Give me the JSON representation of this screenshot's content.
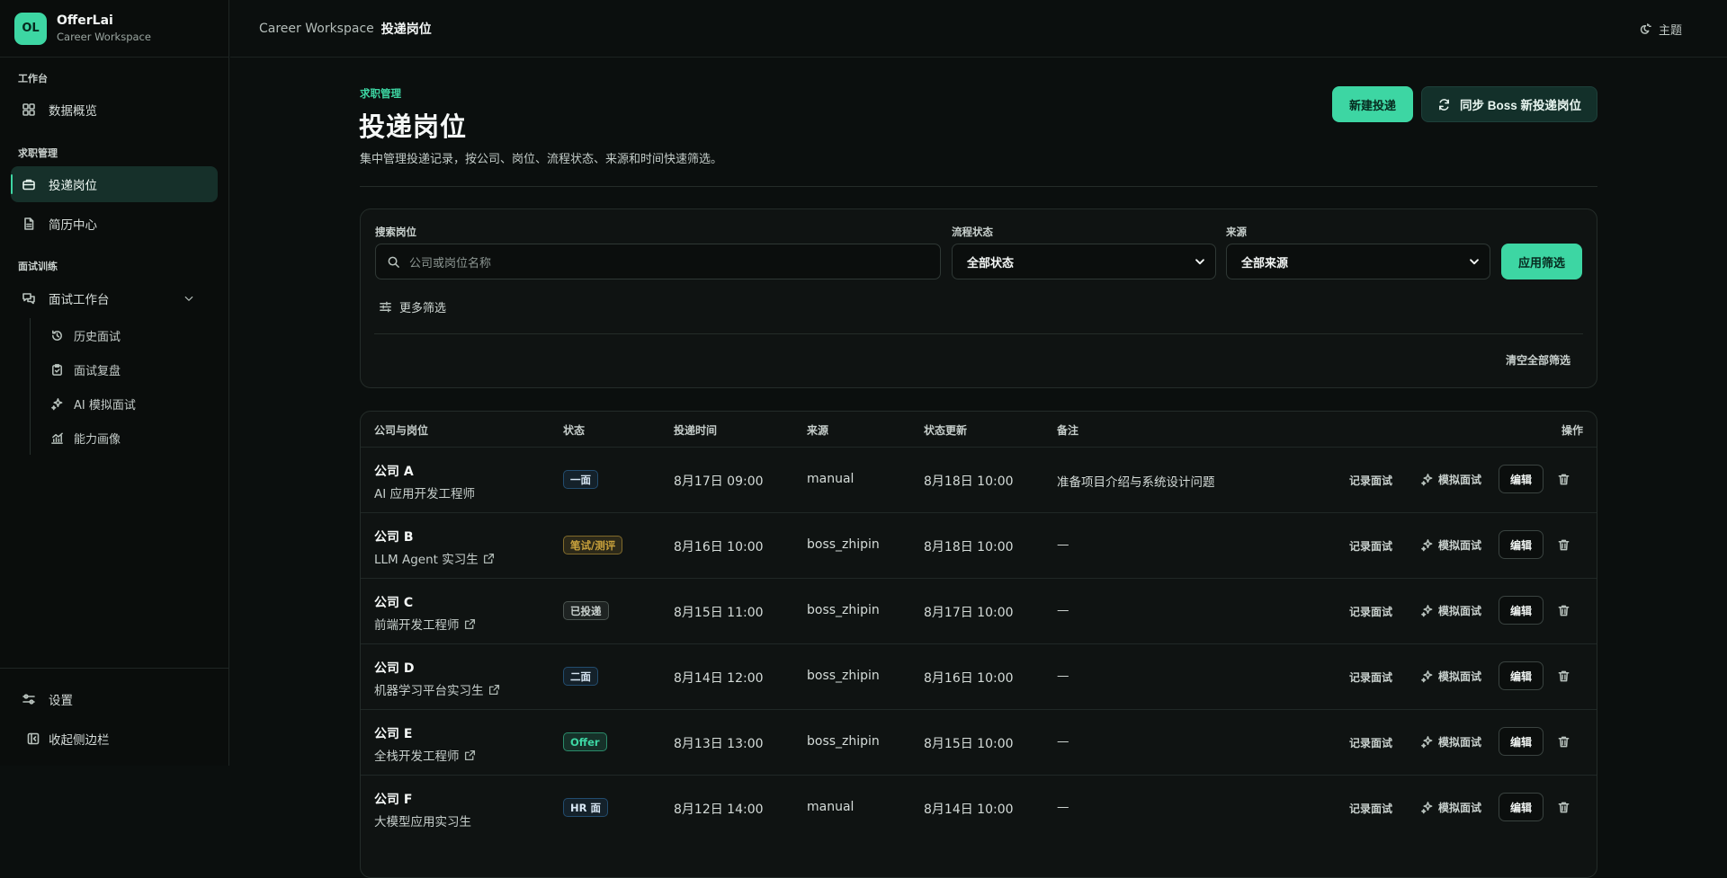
{
  "brand": {
    "logo": "OL",
    "name": "OfferLai",
    "subtitle": "Career Workspace"
  },
  "sidebar": {
    "sections": [
      {
        "title": "工作台",
        "items": [
          {
            "label": "数据概览",
            "icon": "grid-icon"
          }
        ]
      },
      {
        "title": "求职管理",
        "items": [
          {
            "label": "投递岗位",
            "icon": "briefcase-icon",
            "active": true
          },
          {
            "label": "简历中心",
            "icon": "document-icon"
          }
        ]
      },
      {
        "title": "面试训练",
        "items": [
          {
            "label": "面试工作台",
            "icon": "chat-icon",
            "expanded": true
          }
        ]
      }
    ],
    "subitems": [
      {
        "label": "历史面试",
        "icon": "history-icon"
      },
      {
        "label": "面试复盘",
        "icon": "clipboard-icon"
      },
      {
        "label": "AI 模拟面试",
        "icon": "sparkles-icon"
      },
      {
        "label": "能力画像",
        "icon": "chart-icon"
      }
    ],
    "bottom": [
      {
        "label": "设置",
        "icon": "settings-icon"
      },
      {
        "label": "收起侧边栏",
        "icon": "collapse-icon"
      }
    ]
  },
  "topbar": {
    "breadcrumb_root": "Career Workspace",
    "breadcrumb_current": "投递岗位",
    "theme_label": "主题"
  },
  "header": {
    "eyebrow": "求职管理",
    "title": "投递岗位",
    "description": "集中管理投递记录，按公司、岗位、流程状态、来源和时间快速筛选。",
    "new_button": "新建投递",
    "sync_button": "同步 Boss 新投递岗位"
  },
  "filters": {
    "search_label": "搜索岗位",
    "search_placeholder": "公司或岗位名称",
    "status_label": "流程状态",
    "status_value": "全部状态",
    "source_label": "来源",
    "source_value": "全部来源",
    "apply_button": "应用筛选",
    "more_label": "更多筛选",
    "clear_label": "清空全部筛选"
  },
  "table": {
    "columns": [
      "公司与岗位",
      "状态",
      "投递时间",
      "来源",
      "状态更新",
      "备注",
      "操作"
    ],
    "actions": {
      "record": "记录面试",
      "mock": "模拟面试",
      "edit": "编辑"
    },
    "rows": [
      {
        "company": "公司 A",
        "role": "AI 应用开发工程师",
        "link": false,
        "status": "一面",
        "status_color": "#2f6fa8",
        "applied": "8月17日 09:00",
        "source": "manual",
        "updated": "8月18日 10:00",
        "note": "准备项目介绍与系统设计问题"
      },
      {
        "company": "公司 B",
        "role": "LLM Agent 实习生",
        "link": true,
        "status": "笔试/测评",
        "status_color": "#c9a23c",
        "applied": "8月16日 10:00",
        "source": "boss_zhipin",
        "updated": "8月18日 10:00",
        "note": "—"
      },
      {
        "company": "公司 C",
        "role": "前端开发工程师",
        "link": true,
        "status": "已投递",
        "status_color": "#6f7a76",
        "applied": "8月15日 11:00",
        "source": "boss_zhipin",
        "updated": "8月17日 10:00",
        "note": "—"
      },
      {
        "company": "公司 D",
        "role": "机器学习平台实习生",
        "link": true,
        "status": "二面",
        "status_color": "#2f6fa8",
        "applied": "8月14日 12:00",
        "source": "boss_zhipin",
        "updated": "8月16日 10:00",
        "note": "—"
      },
      {
        "company": "公司 E",
        "role": "全栈开发工程师",
        "link": true,
        "status": "Offer",
        "status_color": "#3dd6a3",
        "applied": "8月13日 13:00",
        "source": "boss_zhipin",
        "updated": "8月15日 10:00",
        "note": "—"
      },
      {
        "company": "公司 F",
        "role": "大模型应用实习生",
        "link": false,
        "status": "HR 面",
        "status_color": "#2f6fa8",
        "applied": "8月12日 14:00",
        "source": "manual",
        "updated": "8月14日 10:00",
        "note": "—"
      }
    ]
  }
}
